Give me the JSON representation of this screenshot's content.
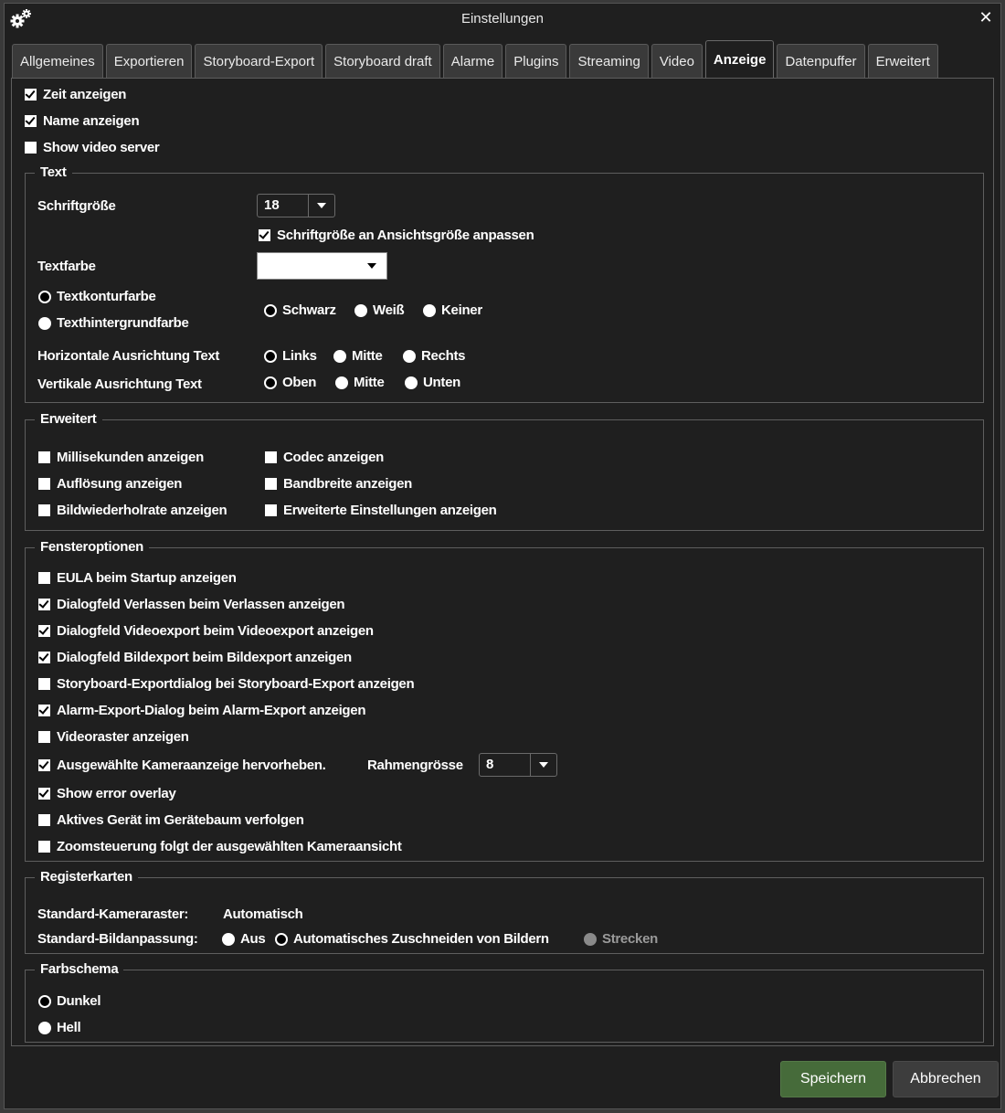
{
  "window": {
    "title": "Einstellungen",
    "icon": "gears-icon",
    "close_icon": "close-icon",
    "close_glyph": "✕"
  },
  "tabs": [
    {
      "label": "Allgemeines",
      "active": false
    },
    {
      "label": "Exportieren",
      "active": false
    },
    {
      "label": "Storyboard-Export",
      "active": false
    },
    {
      "label": "Storyboard draft",
      "active": false
    },
    {
      "label": "Alarme",
      "active": false
    },
    {
      "label": "Plugins",
      "active": false
    },
    {
      "label": "Streaming",
      "active": false
    },
    {
      "label": "Video",
      "active": false
    },
    {
      "label": "Anzeige",
      "active": true
    },
    {
      "label": "Datenpuffer",
      "active": false
    },
    {
      "label": "Erweitert",
      "active": false
    }
  ],
  "top_options": [
    {
      "label": "Zeit anzeigen",
      "checked": true
    },
    {
      "label": "Name anzeigen",
      "checked": true
    },
    {
      "label": "Show video server",
      "checked": false
    }
  ],
  "text_group": {
    "legend": "Text",
    "font_size_label": "Schriftgröße",
    "font_size_value": "18",
    "fit_font_label": "Schriftgröße an Ansichtsgröße anpassen",
    "fit_font_checked": true,
    "text_color_label": "Textfarbe",
    "text_color_value": "#ffffff",
    "mode_options": [
      {
        "label": "Textkonturfarbe",
        "selected": true
      },
      {
        "label": "Texthintergrundfarbe",
        "selected": false
      }
    ],
    "color_options": [
      {
        "label": "Schwarz",
        "selected": true
      },
      {
        "label": "Weiß",
        "selected": false
      },
      {
        "label": "Keiner",
        "selected": false
      }
    ],
    "horizontal_label": "Horizontale Ausrichtung Text",
    "horizontal_options": [
      {
        "label": "Links",
        "selected": true
      },
      {
        "label": "Mitte",
        "selected": false
      },
      {
        "label": "Rechts",
        "selected": false
      }
    ],
    "vertical_label": "Vertikale Ausrichtung Text",
    "vertical_options": [
      {
        "label": "Oben",
        "selected": true
      },
      {
        "label": "Mitte",
        "selected": false
      },
      {
        "label": "Unten",
        "selected": false
      }
    ]
  },
  "advanced_group": {
    "legend": "Erweitert",
    "options": [
      {
        "label": "Millisekunden anzeigen",
        "checked": false
      },
      {
        "label": "Auflösung anzeigen",
        "checked": false
      },
      {
        "label": "Bildwiederholrate anzeigen",
        "checked": false
      },
      {
        "label": "Codec anzeigen",
        "checked": false
      },
      {
        "label": "Bandbreite anzeigen",
        "checked": false
      },
      {
        "label": "Erweiterte Einstellungen anzeigen",
        "checked": false
      }
    ]
  },
  "window_group": {
    "legend": "Fensteroptionen",
    "options": [
      {
        "label": "EULA beim Startup anzeigen",
        "checked": false
      },
      {
        "label": "Dialogfeld Verlassen beim Verlassen anzeigen",
        "checked": true
      },
      {
        "label": "Dialogfeld Videoexport beim Videoexport anzeigen",
        "checked": true
      },
      {
        "label": "Dialogfeld Bildexport beim Bildexport anzeigen",
        "checked": true
      },
      {
        "label": "Storyboard-Exportdialog bei Storyboard-Export anzeigen",
        "checked": false
      },
      {
        "label": "Alarm-Export-Dialog beim Alarm-Export anzeigen",
        "checked": true
      },
      {
        "label": "Videoraster anzeigen",
        "checked": false
      },
      {
        "label": "Ausgewählte Kameraanzeige hervorheben.",
        "checked": true
      },
      {
        "label": "Show error overlay",
        "checked": true
      },
      {
        "label": "Aktives Gerät im Gerätebaum verfolgen",
        "checked": false
      },
      {
        "label": "Zoomsteuerung folgt der ausgewählten Kameraansicht",
        "checked": false
      }
    ],
    "frame_size_label": "Rahmengrösse",
    "frame_size_value": "8"
  },
  "tabs_group": {
    "legend": "Registerkarten",
    "grid_label": "Standard-Kameraraster:",
    "grid_value": "Automatisch",
    "fit_label": "Standard-Bildanpassung:",
    "fit_options": [
      {
        "label": "Aus",
        "selected": false,
        "disabled": false
      },
      {
        "label": "Automatisches Zuschneiden von Bildern",
        "selected": true,
        "disabled": false
      },
      {
        "label": "Strecken",
        "selected": false,
        "disabled": true
      }
    ]
  },
  "scheme_group": {
    "legend": "Farbschema",
    "options": [
      {
        "label": "Dunkel",
        "selected": true
      },
      {
        "label": "Hell",
        "selected": false
      }
    ]
  },
  "footer": {
    "save_label": "Speichern",
    "cancel_label": "Abbrechen",
    "save_color": "#466b3a"
  }
}
